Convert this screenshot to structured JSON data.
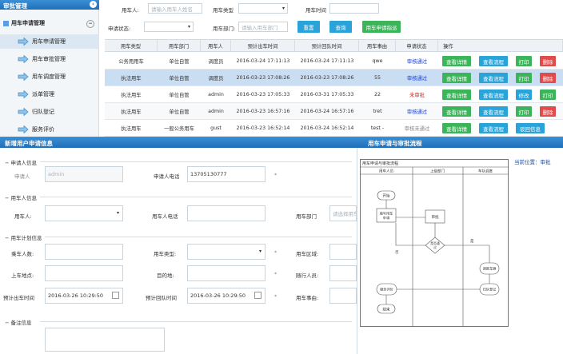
{
  "sidebar": {
    "title": "审批管理",
    "group": "用车申请管理",
    "items": [
      "用车申请管理",
      "用车审批管理",
      "用车调度管理",
      "派单管理",
      "归队登记",
      "服务评价"
    ]
  },
  "filters": {
    "user_label": "用车人:",
    "user_placeholder": "请输入用车人姓名",
    "type_label": "用车类型",
    "time_label": "用车时间",
    "status_label": "申请状态:",
    "dept_label": "用车部门:",
    "dept_placeholder": "请输入用车部门",
    "reset": "重置",
    "search": "查询",
    "apply": "用车申请指派"
  },
  "table": {
    "headers": [
      "用车类型",
      "用车部门",
      "用车人",
      "预计出车时间",
      "预计回队时间",
      "用车事由",
      "申请状态",
      "操作"
    ],
    "rows": [
      {
        "type": "公务用用车",
        "dept": "单位自管",
        "user": "调度员",
        "out": "2016-03-24 17:11:13",
        "back": "2016-03-24 17:11:13",
        "reason": "qwe",
        "status": "审核通过",
        "actions": [
          "查看详情",
          "查看流程",
          "打印",
          "删除"
        ]
      },
      {
        "type": "执法用车",
        "dept": "单位自管",
        "user": "调度员",
        "out": "2016-03-23 17:08:26",
        "back": "2016-03-23 17:08:26",
        "reason": "55",
        "status": "审核通过",
        "actions": [
          "查看详情",
          "查看流程",
          "打印",
          "删除"
        ]
      },
      {
        "type": "执法用车",
        "dept": "单位自管",
        "user": "admin",
        "out": "2016-03-23 17:05:33",
        "back": "2016-03-31 17:05:33",
        "reason": "22",
        "status": "未审批",
        "actions": [
          "查看详情",
          "查看流程",
          "修改",
          "打印"
        ]
      },
      {
        "type": "执法用车",
        "dept": "单位自管",
        "user": "admin",
        "out": "2016-03-23 16:57:16",
        "back": "2016-03-24 16:57:16",
        "reason": "tret",
        "status": "审核通过",
        "actions": [
          "查看详情",
          "查看流程",
          "打印",
          "删除"
        ]
      },
      {
        "type": "执法用车",
        "dept": "一般公务用车",
        "user": "gust",
        "out": "2016-03-23 16:52:14",
        "back": "2016-03-24 16:52:14",
        "reason": "test -",
        "status": "审核未通过",
        "actions": [
          "查看详情",
          "查看流程",
          "驳回信息"
        ]
      }
    ]
  },
  "form": {
    "title": "新增用户申请信息",
    "applicant_section": "申请人信息",
    "applicant_label": "申请人",
    "applicant_value": "admin",
    "applicant_phone_label": "申请人电话",
    "applicant_phone_value": "13705130777",
    "user_section": "用车人信息",
    "user_label": "用车人:",
    "user_phone_label": "用车人电话",
    "user_dept_label": "用车部门",
    "user_dept_placeholder": "请选择用车",
    "plan_section": "用车计划信息",
    "passengers_label": "乘车人数:",
    "car_type_label": "用车类型:",
    "area_label": "用车区域:",
    "pickup_label": "上车地点:",
    "destination_label": "目的地:",
    "companions_label": "随行人员:",
    "out_time_label": "预计出车时间",
    "out_time_value": "2016-03-26 10:29:50",
    "back_time_label": "预计回队时间",
    "back_time_value": "2016-03-26 10:29:50",
    "reason_label": "用车事由:",
    "remark_section": "备注信息",
    "required": "*"
  },
  "flow": {
    "title": "用车申请与审批流程",
    "location": "当前位置：审批",
    "diagram_title": "用车申请与审批流程",
    "lanes": [
      "用车人员",
      "上级部门",
      "车队调度"
    ],
    "nodes": {
      "start": "开始",
      "fill": "填写用车\n申请",
      "approve": "审批",
      "passed": "是否通过",
      "dispatch": "调度车辆",
      "return": "归队登记",
      "evaluate": "服务评价",
      "end": "结束"
    },
    "yes": "是",
    "no": "否"
  },
  "colors": {
    "header": "#2a7cc7",
    "green": "#3cb55a",
    "blue": "#2aa3d8",
    "red": "#e04b4b",
    "teal": "#2e9bc4",
    "pass": "#1a3fd1",
    "pending": "#e02020"
  }
}
